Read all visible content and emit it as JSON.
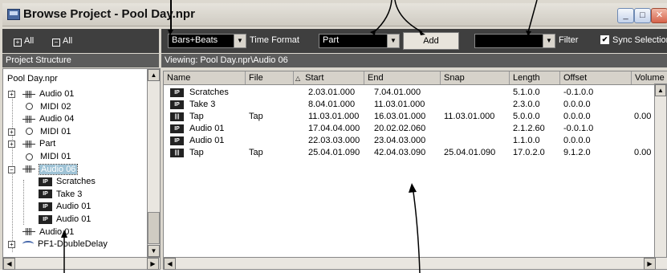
{
  "window": {
    "title": "Browse Project - Pool Day.npr",
    "minimize": "_",
    "maximize": "□",
    "close": "✕"
  },
  "left_toolbar": {
    "expand_all": "All",
    "collapse_all": "All",
    "expand_symbol": "+",
    "collapse_symbol": "−"
  },
  "toolbar": {
    "time_format_value": "Bars+Beats",
    "time_format_label": "Time Format",
    "type_value": "Part",
    "add_label": "Add",
    "filter_value": "",
    "filter_label": "Filter",
    "sync_label": "Sync Selection",
    "sync_checked": "✔"
  },
  "project_structure": {
    "header": "Project Structure",
    "root": "Pool Day.npr",
    "items": [
      {
        "label": "Audio 01",
        "icon": "audio-track-icon",
        "expand": "+"
      },
      {
        "label": "MIDI 02",
        "icon": "midi-track-icon",
        "expand": ""
      },
      {
        "label": "Audio 04",
        "icon": "audio-track-icon",
        "expand": ""
      },
      {
        "label": "MIDI 01",
        "icon": "midi-track-icon",
        "expand": "+"
      },
      {
        "label": "Part",
        "icon": "audio-track-icon",
        "expand": "+"
      },
      {
        "label": "MIDI 01",
        "icon": "midi-track-icon",
        "expand": ""
      },
      {
        "label": "Audio 06",
        "icon": "audio-track-icon",
        "expand": "−"
      },
      {
        "label": "Scratches",
        "icon": "audio-part-icon",
        "expand": ""
      },
      {
        "label": "Take 3",
        "icon": "audio-part-icon",
        "expand": ""
      },
      {
        "label": "Audio 01",
        "icon": "audio-part-icon",
        "expand": ""
      },
      {
        "label": "Audio 01",
        "icon": "audio-part-icon",
        "expand": ""
      },
      {
        "label": "Audio 01",
        "icon": "audio-track-icon",
        "expand": ""
      },
      {
        "label": "PF1-DoubleDelay",
        "icon": "plugin-icon",
        "expand": "+"
      }
    ]
  },
  "viewing": "Viewing: Pool Day.npr\\Audio 06",
  "table": {
    "sort_indicator": "△",
    "columns": [
      "Name",
      "File",
      "Start",
      "End",
      "Snap",
      "Length",
      "Offset",
      "Volume"
    ],
    "rows": [
      {
        "icon": "part-icon",
        "name": "Scratches",
        "file": "",
        "start": "2.03.01.000",
        "end": "7.04.01.000",
        "snap": "",
        "length": "5.1.0.0",
        "offset": "-0.1.0.0",
        "volume": ""
      },
      {
        "icon": "part-icon",
        "name": "Take 3",
        "file": "",
        "start": "8.04.01.000",
        "end": "11.03.01.000",
        "snap": "",
        "length": "2.3.0.0",
        "offset": "0.0.0.0",
        "volume": ""
      },
      {
        "icon": "event-icon",
        "name": "Tap",
        "file": "Tap",
        "start": "11.03.01.000",
        "end": "16.03.01.000",
        "snap": "11.03.01.000",
        "length": "5.0.0.0",
        "offset": "0.0.0.0",
        "volume": "0.00"
      },
      {
        "icon": "part-icon",
        "name": "Audio 01",
        "file": "",
        "start": "17.04.04.000",
        "end": "20.02.02.060",
        "snap": "",
        "length": "2.1.2.60",
        "offset": "-0.0.1.0",
        "volume": ""
      },
      {
        "icon": "part-icon",
        "name": "Audio 01",
        "file": "",
        "start": "22.03.03.000",
        "end": "23.04.03.000",
        "snap": "",
        "length": "1.1.0.0",
        "offset": "0.0.0.0",
        "volume": ""
      },
      {
        "icon": "event-icon",
        "name": "Tap",
        "file": "Tap",
        "start": "25.04.01.090",
        "end": "42.04.03.090",
        "snap": "25.04.01.090",
        "length": "17.0.2.0",
        "offset": "9.1.2.0",
        "volume": "0.00"
      }
    ]
  },
  "scroll_glyphs": {
    "up": "▲",
    "down": "▼",
    "left": "◀",
    "right": "▶",
    "dropdown": "▼"
  }
}
